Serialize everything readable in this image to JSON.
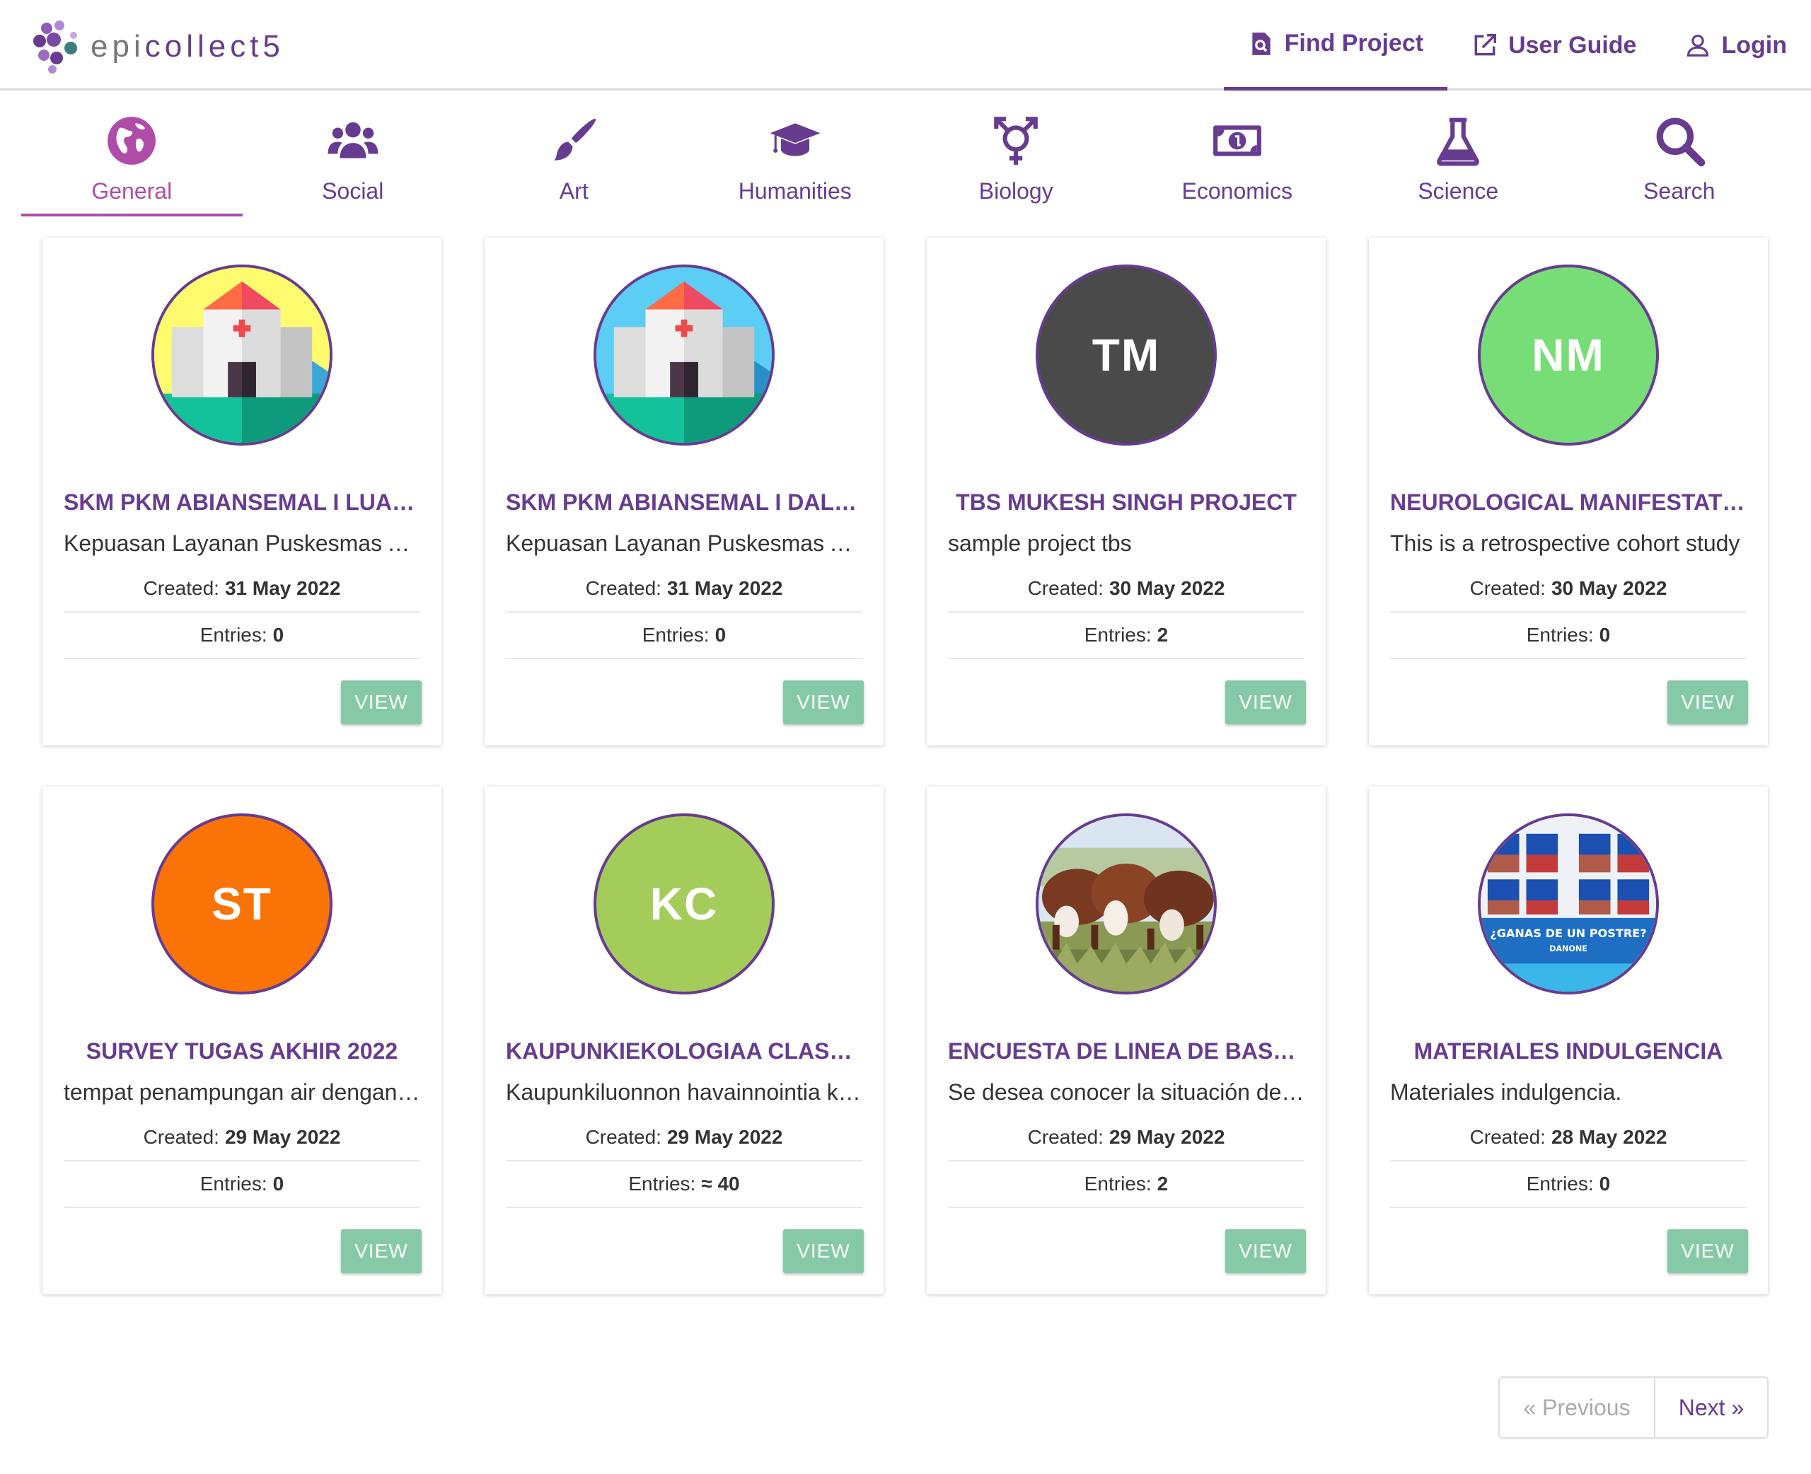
{
  "header": {
    "logo_prefix": "epi",
    "logo_suffix": "collect5",
    "nav": [
      {
        "label": "Find Project",
        "icon": "find-project-icon",
        "active": true
      },
      {
        "label": "User Guide",
        "icon": "external-link-icon"
      },
      {
        "label": "Login",
        "icon": "user-icon"
      }
    ]
  },
  "tabs": [
    {
      "label": "General",
      "icon": "globe-icon",
      "active": true
    },
    {
      "label": "Social",
      "icon": "users-icon"
    },
    {
      "label": "Art",
      "icon": "paintbrush-icon"
    },
    {
      "label": "Humanities",
      "icon": "graduation-cap-icon"
    },
    {
      "label": "Biology",
      "icon": "gender-icon"
    },
    {
      "label": "Economics",
      "icon": "money-icon"
    },
    {
      "label": "Science",
      "icon": "flask-icon"
    },
    {
      "label": "Search",
      "icon": "search-icon"
    }
  ],
  "labels": {
    "created": "Created:",
    "entries": "Entries:",
    "view": "VIEW"
  },
  "projects": [
    {
      "title": "SKM PKM ABIANSEMAL I LUAR GEDUNG",
      "description": "Kepuasan Layanan Puskesmas Abiansemal I",
      "created": "31 May 2022",
      "entries": "0",
      "avatar": {
        "type": "image",
        "icon": "hospital-yellow-icon"
      }
    },
    {
      "title": "SKM PKM ABIANSEMAL I DALAM GEDUNG",
      "description": "Kepuasan Layanan Puskesmas Abiansemal I",
      "created": "31 May 2022",
      "entries": "0",
      "avatar": {
        "type": "image",
        "icon": "hospital-blue-icon"
      }
    },
    {
      "title": "TBS MUKESH SINGH PROJECT",
      "description": "sample project tbs",
      "created": "30 May 2022",
      "entries": "2",
      "avatar": {
        "type": "initials",
        "text": "TM",
        "color": "#4a4a4a"
      }
    },
    {
      "title": "NEUROLOGICAL MANIFESTATIONS",
      "description": "This is a retrospective cohort study",
      "created": "30 May 2022",
      "entries": "0",
      "avatar": {
        "type": "initials",
        "text": "NM",
        "color": "#77dd77"
      }
    },
    {
      "title": "SURVEY TUGAS AKHIR 2022",
      "description": "tempat penampungan air dengan jentik",
      "created": "29 May 2022",
      "entries": "0",
      "avatar": {
        "type": "initials",
        "text": "ST",
        "color": "#f97306"
      }
    },
    {
      "title": "KAUPUNKIEKOLOGIAA CLASUNIT",
      "description": "Kaupunkiluonnon havainnointia kaupungissa",
      "created": "29 May 2022",
      "entries": "≈ 40",
      "avatar": {
        "type": "initials",
        "text": "KC",
        "color": "#a4cc5a"
      }
    },
    {
      "title": "ENCUESTA DE LINEA DE BASE GANADERA",
      "description": "Se desea conocer la situación de los productores",
      "created": "29 May 2022",
      "entries": "2",
      "avatar": {
        "type": "image",
        "icon": "cattle-photo-icon"
      }
    },
    {
      "title": "MATERIALES INDULGENCIA",
      "description": "Materiales indulgencia.",
      "created": "28 May 2022",
      "entries": "0",
      "avatar": {
        "type": "image",
        "icon": "danone-photo-icon",
        "caption": "¿GANAS DE UN POSTRE?",
        "brand": "DANONE"
      }
    }
  ],
  "pagination": {
    "previous": "« Previous",
    "next": "Next »"
  },
  "colors": {
    "brand_purple": "#673c90",
    "active_tab": "#b04ca8",
    "view_button": "#85c9a6"
  }
}
